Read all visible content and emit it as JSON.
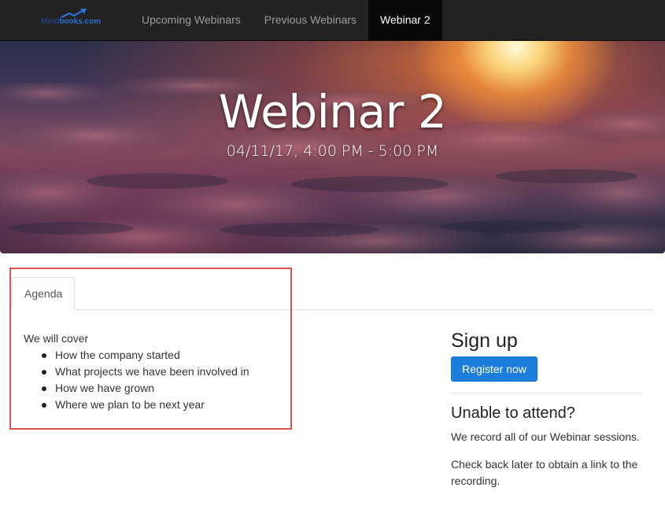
{
  "navbar": {
    "brand": {
      "text_part1": "Mind",
      "text_part2": "books.com",
      "icon": "rising-chart-logo-icon"
    },
    "items": [
      {
        "label": "Upcoming Webinars",
        "active": false
      },
      {
        "label": "Previous Webinars",
        "active": false
      },
      {
        "label": "Webinar 2",
        "active": true
      }
    ]
  },
  "hero": {
    "title": "Webinar 2",
    "datetime": "04/11/17, 4:00 PM - 5:00 PM"
  },
  "tabs": [
    {
      "label": "Agenda",
      "active": true
    }
  ],
  "agenda": {
    "intro": "We will cover",
    "items": [
      "How the company started",
      "What projects we have been involved in",
      "How we have grown",
      "Where we plan to be next year"
    ]
  },
  "signup": {
    "title": "Sign up",
    "register_label": "Register now",
    "unable_title": "Unable to attend?",
    "unable_text1": "We record all of our Webinar sessions.",
    "unable_text2": "Check back later to obtain a link to the recording."
  },
  "colors": {
    "navbar_bg": "#222222",
    "nav_active_bg": "#080808",
    "primary_button": "#1c7edc",
    "highlight_box": "#e0504c"
  }
}
